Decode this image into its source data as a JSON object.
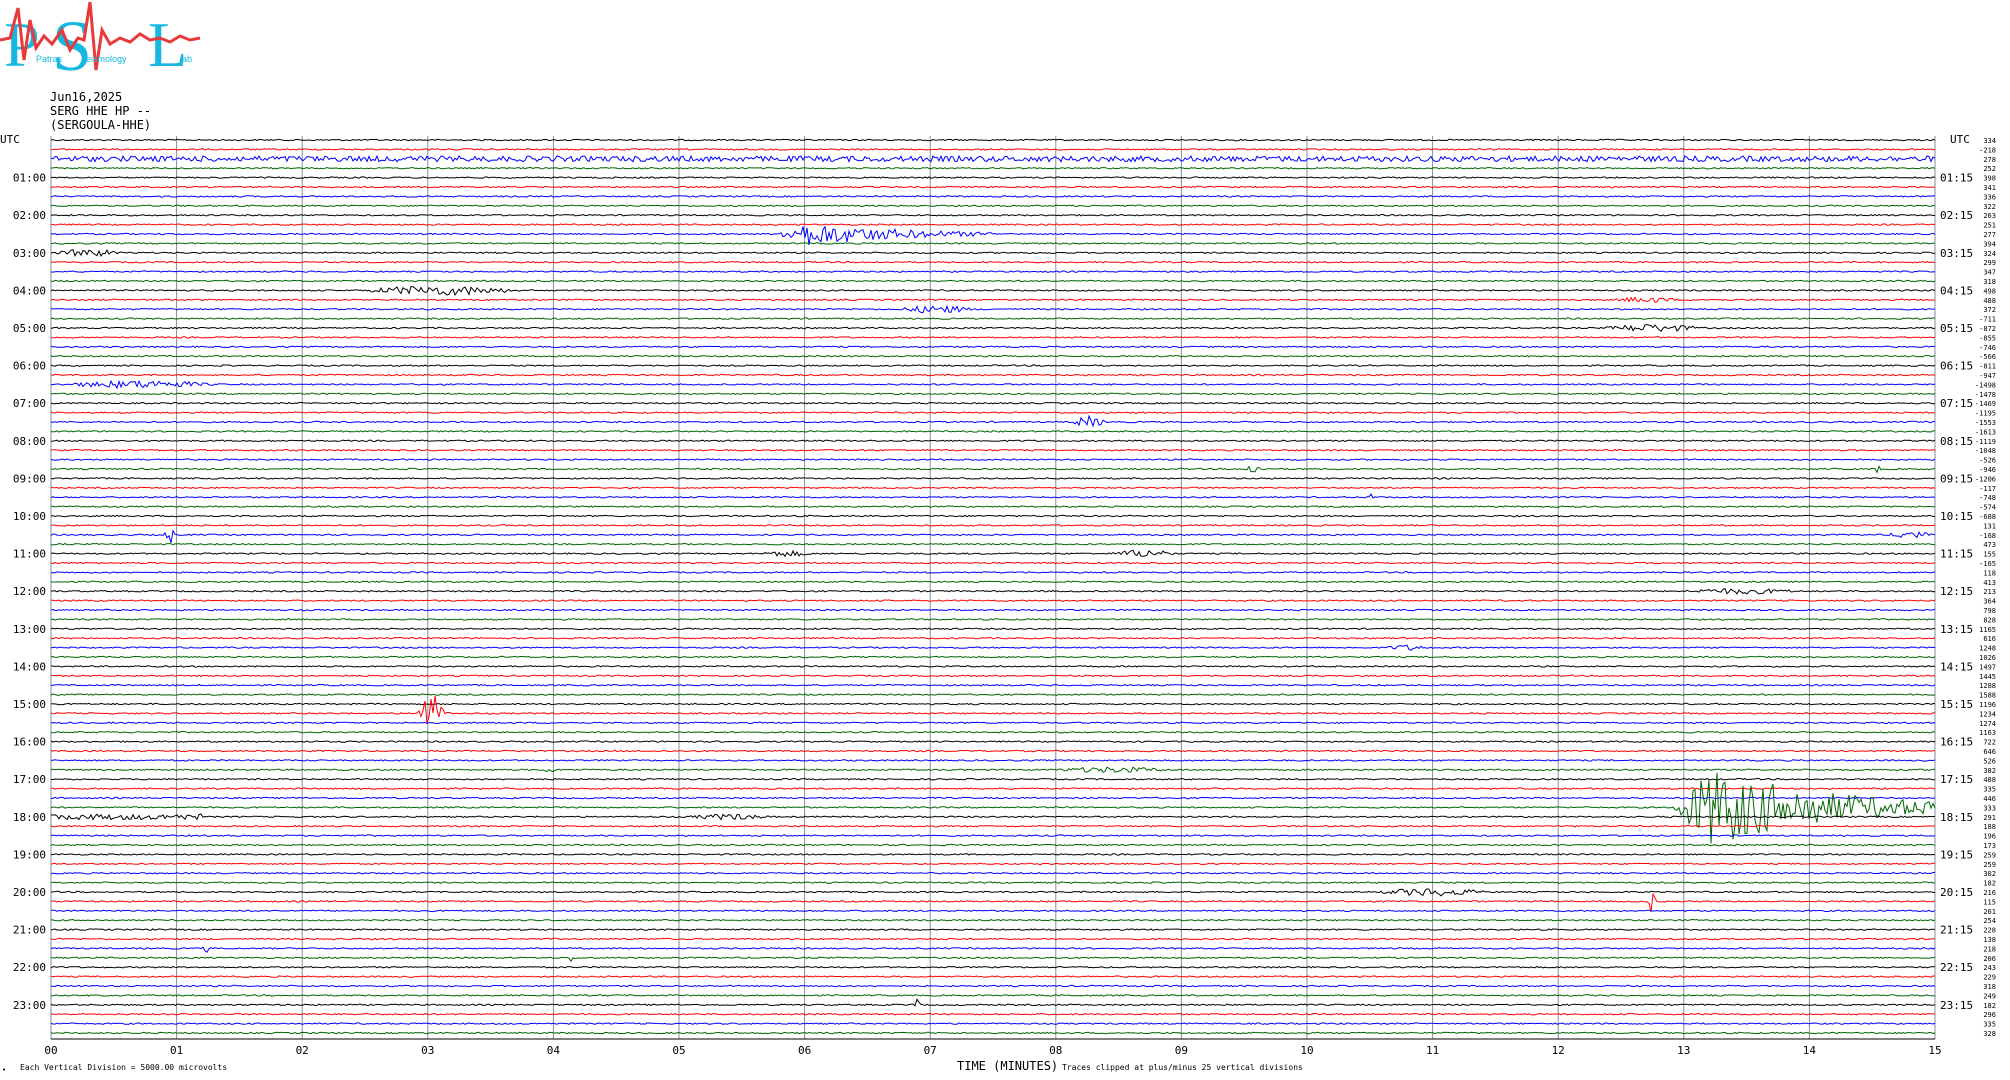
{
  "logo": {
    "letters": [
      "P",
      "S",
      "L"
    ],
    "words": [
      "Patras",
      "eismology",
      "ab"
    ]
  },
  "header": {
    "date": "Jun16,2025",
    "channel": "SERG HHE HP --",
    "station": "(SERGOULA-HHE)"
  },
  "utc_label": "UTC",
  "footer": {
    "scale_note": "Each Vertical Division = 5000.00 microvolts",
    "time_label": "TIME (MINUTES)",
    "clip_note": "Traces clipped at plus/minus 25 vertical divisions",
    "corner_mark": "•"
  },
  "colors": {
    "black": "#000000",
    "red": "#ff0000",
    "blue": "#0000ff",
    "green": "#006600",
    "grid": "#7f8fa5"
  },
  "chart_data": {
    "type": "line",
    "title": "",
    "xlabel": "TIME (MINUTES)",
    "ylabel": "UTC",
    "x_ticks": [
      "00",
      "01",
      "02",
      "03",
      "04",
      "05",
      "06",
      "07",
      "08",
      "09",
      "10",
      "11",
      "12",
      "13",
      "14",
      "15"
    ],
    "xlim": [
      0,
      15
    ],
    "left_hour_labels": [
      "01:00",
      "02:00",
      "03:00",
      "04:00",
      "05:00",
      "06:00",
      "07:00",
      "08:00",
      "09:00",
      "10:00",
      "11:00",
      "12:00",
      "13:00",
      "14:00",
      "15:00",
      "16:00",
      "17:00",
      "18:00",
      "19:00",
      "20:00",
      "21:00",
      "22:00",
      "23:00"
    ],
    "right_hour_labels": [
      "01:15",
      "02:15",
      "03:15",
      "04:15",
      "05:15",
      "06:15",
      "07:15",
      "08:15",
      "09:15",
      "10:15",
      "11:15",
      "12:15",
      "13:15",
      "14:15",
      "15:15",
      "16:15",
      "17:15",
      "18:15",
      "19:15",
      "20:15",
      "21:15",
      "22:15",
      "23:15"
    ],
    "trace_color_cycle": [
      "black",
      "red",
      "blue",
      "green"
    ],
    "trace_count": 96,
    "trace_offsets": [
      "334",
      "-218",
      "278",
      "252",
      "398",
      "341",
      "336",
      "322",
      "263",
      "251",
      "277",
      "394",
      "324",
      "299",
      "347",
      "318",
      "498",
      "488",
      "372",
      "-711",
      "-872",
      "-855",
      "-746",
      "-566",
      "-811",
      "-947",
      "-1498",
      "-1478",
      "-1469",
      "-1195",
      "-1553",
      "-1613",
      "-1119",
      "-1048",
      "-526",
      "-946",
      "-1206",
      "-117",
      "-748",
      "-574",
      "-688",
      "131",
      "-168",
      "473",
      "155",
      "-165",
      "118",
      "413",
      "213",
      "364",
      "798",
      "828",
      "1165",
      "616",
      "1248",
      "1026",
      "1497",
      "1445",
      "1288",
      "1588",
      "1196",
      "1234",
      "1274",
      "1163",
      "722",
      "646",
      "526",
      "382",
      "488",
      "335",
      "446",
      "333",
      "291",
      "188",
      "196",
      "173",
      "259",
      "259",
      "302",
      "182",
      "216",
      "115",
      "261",
      "254",
      "228",
      "138",
      "218",
      "206",
      "243",
      "229",
      "318",
      "249",
      "182",
      "296",
      "335",
      "328"
    ],
    "events": [
      {
        "trace": 2,
        "start_min": 0.0,
        "end_min": 15.0,
        "amp": 4,
        "kind": "noise"
      },
      {
        "trace": 10,
        "start_min": 5.75,
        "end_min": 7.5,
        "amp": 12,
        "kind": "quake"
      },
      {
        "trace": 12,
        "start_min": 0.0,
        "end_min": 0.6,
        "amp": 4,
        "kind": "burst"
      },
      {
        "trace": 16,
        "start_min": 2.4,
        "end_min": 3.8,
        "amp": 5,
        "kind": "burst"
      },
      {
        "trace": 17,
        "start_min": 12.4,
        "end_min": 13.0,
        "amp": 3,
        "kind": "burst"
      },
      {
        "trace": 18,
        "start_min": 6.7,
        "end_min": 7.4,
        "amp": 4,
        "kind": "burst"
      },
      {
        "trace": 20,
        "start_min": 12.3,
        "end_min": 13.2,
        "amp": 4,
        "kind": "burst"
      },
      {
        "trace": 26,
        "start_min": 0.0,
        "end_min": 1.4,
        "amp": 4,
        "kind": "burst"
      },
      {
        "trace": 30,
        "start_min": 8.1,
        "end_min": 8.5,
        "amp": 6,
        "kind": "spike"
      },
      {
        "trace": 35,
        "start_min": 9.5,
        "end_min": 9.7,
        "amp": 6,
        "kind": "spike"
      },
      {
        "trace": 35,
        "start_min": 14.5,
        "end_min": 14.6,
        "amp": 4,
        "kind": "spike"
      },
      {
        "trace": 38,
        "start_min": 10.5,
        "end_min": 10.55,
        "amp": 6,
        "kind": "spike"
      },
      {
        "trace": 42,
        "start_min": 0.9,
        "end_min": 1.0,
        "amp": 14,
        "kind": "spike"
      },
      {
        "trace": 42,
        "start_min": 14.6,
        "end_min": 15.0,
        "amp": 4,
        "kind": "burst"
      },
      {
        "trace": 44,
        "start_min": 5.6,
        "end_min": 6.1,
        "amp": 3,
        "kind": "burst"
      },
      {
        "trace": 44,
        "start_min": 8.4,
        "end_min": 9.0,
        "amp": 4,
        "kind": "burst"
      },
      {
        "trace": 48,
        "start_min": 12.9,
        "end_min": 14.0,
        "amp": 3,
        "kind": "burst"
      },
      {
        "trace": 54,
        "start_min": 10.6,
        "end_min": 11.0,
        "amp": 3,
        "kind": "burst"
      },
      {
        "trace": 61,
        "start_min": 2.9,
        "end_min": 3.2,
        "amp": 22,
        "kind": "spike"
      },
      {
        "trace": 67,
        "start_min": 7.9,
        "end_min": 9.0,
        "amp": 3,
        "kind": "burst"
      },
      {
        "trace": 67,
        "start_min": 3.9,
        "end_min": 4.1,
        "amp": 3,
        "kind": "spike"
      },
      {
        "trace": 71,
        "start_min": 12.9,
        "end_min": 15.0,
        "amp": 40,
        "kind": "quake"
      },
      {
        "trace": 72,
        "start_min": 0.0,
        "end_min": 1.2,
        "amp": 4,
        "kind": "noise"
      },
      {
        "trace": 72,
        "start_min": 5.0,
        "end_min": 5.8,
        "amp": 3,
        "kind": "burst"
      },
      {
        "trace": 80,
        "start_min": 10.5,
        "end_min": 11.5,
        "amp": 4,
        "kind": "burst"
      },
      {
        "trace": 81,
        "start_min": 12.7,
        "end_min": 12.8,
        "amp": 12,
        "kind": "spike"
      },
      {
        "trace": 86,
        "start_min": 1.2,
        "end_min": 1.3,
        "amp": 4,
        "kind": "spike"
      },
      {
        "trace": 87,
        "start_min": 4.1,
        "end_min": 4.2,
        "amp": 4,
        "kind": "spike"
      },
      {
        "trace": 92,
        "start_min": 6.85,
        "end_min": 6.95,
        "amp": 6,
        "kind": "spike"
      }
    ]
  }
}
